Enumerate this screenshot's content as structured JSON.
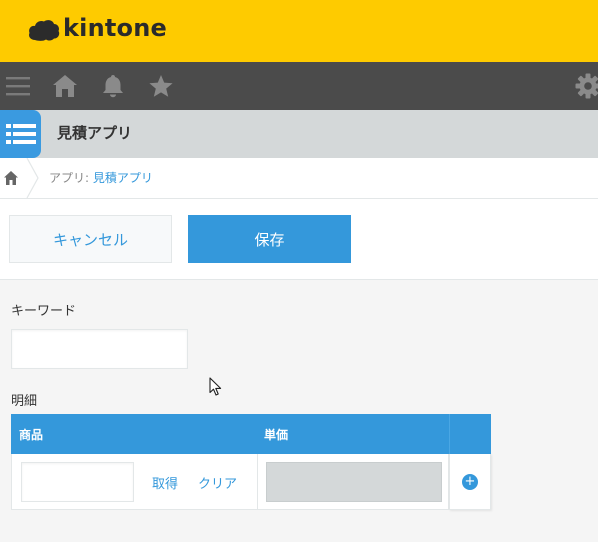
{
  "brand": {
    "name": "kintone",
    "color": "#fecb00"
  },
  "nav": {
    "icons": [
      "menu-icon",
      "home-icon",
      "bell-icon",
      "star-icon",
      "gear-icon"
    ]
  },
  "app": {
    "name": "見積アプリ",
    "accent": "#3a9ae0"
  },
  "breadcrumb": {
    "prefix": "アプリ: ",
    "link": "見積アプリ"
  },
  "toolbar": {
    "cancel_label": "キャンセル",
    "save_label": "保存"
  },
  "form": {
    "keyword": {
      "label": "キーワード",
      "value": ""
    },
    "detail": {
      "label": "明細",
      "columns": [
        "商品",
        "単価"
      ],
      "rows": [
        {
          "product": "",
          "fetch_label": "取得",
          "clear_label": "クリア",
          "price": ""
        }
      ],
      "add_label": "+"
    }
  },
  "colors": {
    "primary": "#3498db",
    "nav": "#4b4b4b",
    "appbar": "#d4d8d9"
  }
}
